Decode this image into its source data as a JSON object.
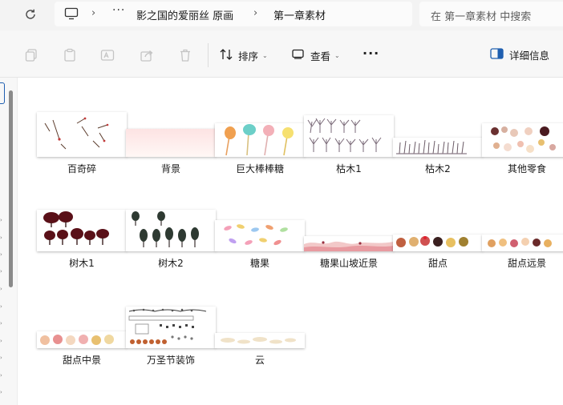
{
  "address": {
    "ellipsis": "···",
    "crumbs": [
      "影之国的爱丽丝 原画",
      "第一章素材"
    ],
    "search_placeholder": "在 第一章素材 中搜索"
  },
  "toolbar": {
    "sort_label": "排序",
    "view_label": "查看",
    "more_label": "···",
    "details_label": "详细信息"
  },
  "files": [
    {
      "name": "百奇碎"
    },
    {
      "name": "背景"
    },
    {
      "name": "巨大棒棒糖"
    },
    {
      "name": "枯木1"
    },
    {
      "name": "枯木2"
    },
    {
      "name": "其他零食"
    },
    {
      "name": "树木1"
    },
    {
      "name": "树木2"
    },
    {
      "name": "糖果"
    },
    {
      "name": "糖果山坡近景"
    },
    {
      "name": "甜点"
    },
    {
      "name": "甜点远景"
    },
    {
      "name": "甜点中景"
    },
    {
      "name": "万圣节装饰"
    },
    {
      "name": "云"
    }
  ],
  "colors": {
    "nav_selection": "#1f5fb0",
    "tree_dark_red": "#5a1018",
    "lollipop_orange": "#f0a050",
    "lollipop_teal": "#6ccfc8"
  }
}
